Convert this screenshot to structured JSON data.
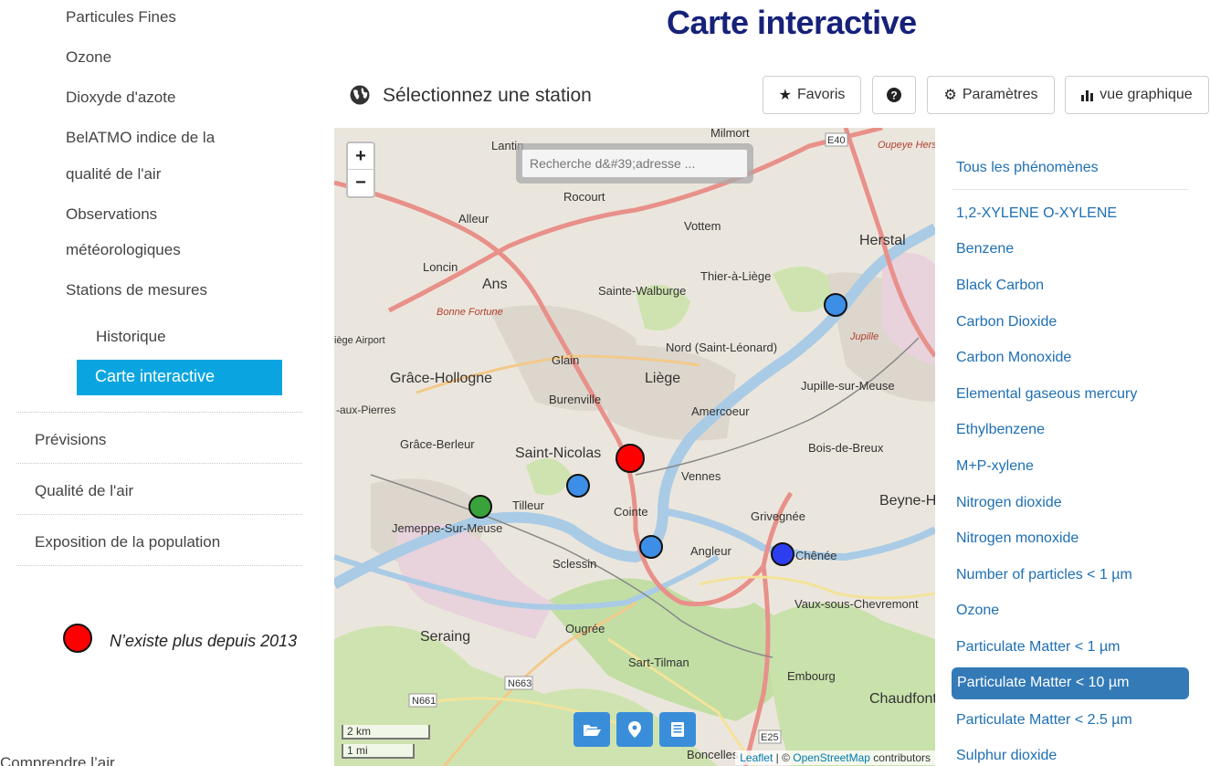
{
  "sidebar": {
    "top_links": [
      "Particules Fines",
      "Ozone",
      "Dioxyde d'azote",
      "BelATMO indice de la",
      "qualité de l'air",
      "Observations",
      "météorologiques",
      "Stations de mesures"
    ],
    "sub_links": [
      "Historique",
      "Carte interactive"
    ],
    "active_item": "Carte interactive",
    "main_items": [
      "Prévisions",
      "Qualité de l'air",
      "Exposition de la population"
    ]
  },
  "legend": {
    "text": "N’existe plus depuis 2013",
    "color": "#ff0000"
  },
  "partial_footer_text": "Comprendre l’air",
  "header": {
    "title": "Carte interactive",
    "station_label": "Sélectionnez une station"
  },
  "toolbar": {
    "favorites": "Favoris",
    "help_icon": "question-circle-icon",
    "settings": "Paramètres",
    "graph_view": "vue graphique"
  },
  "map": {
    "zoom_in": "+",
    "zoom_out": "−",
    "search_placeholder": "Recherche d&#39;adresse ...",
    "scale_km": "2 km",
    "scale_mi": "1 mi",
    "attribution_leaflet": "Leaflet",
    "attribution_sep": " | © ",
    "attribution_osm": "OpenStreetMap",
    "attribution_suffix": " contributors",
    "bottom_buttons": [
      "folder-open-icon",
      "map-marker-icon",
      "list-icon"
    ],
    "place_labels": [
      "Lantin",
      "Milmort",
      "Vottem",
      "Herstal",
      "Alleur",
      "Rocourt",
      "Loncin",
      "Ans",
      "Thier-à-Liège",
      "Sainte-Walburge",
      "Nord (Saint-Léonard)",
      "Glain",
      "Liège",
      "Grâce-Hollogne",
      "Jupille-sur-Meuse",
      "Burenville",
      "Amercoeur",
      "Grâce-Berleur",
      "Saint-Nicolas",
      "Bois-de-Breux",
      "Vennes",
      "Tilleur",
      "Cointe",
      "Grivegnée",
      "Beyne-He",
      "Jemeppe-Sur-Meuse",
      "Sclessin",
      "Angleur",
      "Chênée",
      "Vaux-sous-Chevremont",
      "Ougrée",
      "Seraing",
      "Sart-Tilman",
      "Embourg",
      "Chaudfontai",
      "Boncelles",
      "N663",
      "N661",
      "E25",
      "E40",
      "Bonne Fortune",
      "Liège Airport",
      "aux-Pierres",
      "Jupille",
      "Oupeye Herstal"
    ],
    "stations": [
      {
        "status": "active",
        "color": "#3d8ee6"
      },
      {
        "status": "discontinued",
        "color": "#ff0000"
      },
      {
        "status": "active",
        "color": "#3d8ee6"
      },
      {
        "status": "active",
        "color": "#3aa23a"
      },
      {
        "status": "active",
        "color": "#3d8ee6"
      },
      {
        "status": "active",
        "color": "#2d3ef0"
      }
    ]
  },
  "phenomena": {
    "all": "Tous les phénomènes",
    "items": [
      "1,2-XYLENE O-XYLENE",
      "Benzene",
      "Black Carbon",
      "Carbon Dioxide",
      "Carbon Monoxide",
      "Elemental gaseous mercury",
      "Ethylbenzene",
      "M+P-xylene",
      "Nitrogen dioxide",
      "Nitrogen monoxide",
      "Number of particles < 1 µm",
      "Ozone",
      "Particulate Matter < 1 µm",
      "Particulate Matter < 10 µm",
      "Particulate Matter < 2.5 µm",
      "Sulphur dioxide"
    ],
    "active": "Particulate Matter < 10 µm"
  },
  "colors": {
    "accent": "#0aa5e0",
    "title": "#16217a",
    "link": "#1e6fb3",
    "active_pill": "#337ab7"
  }
}
